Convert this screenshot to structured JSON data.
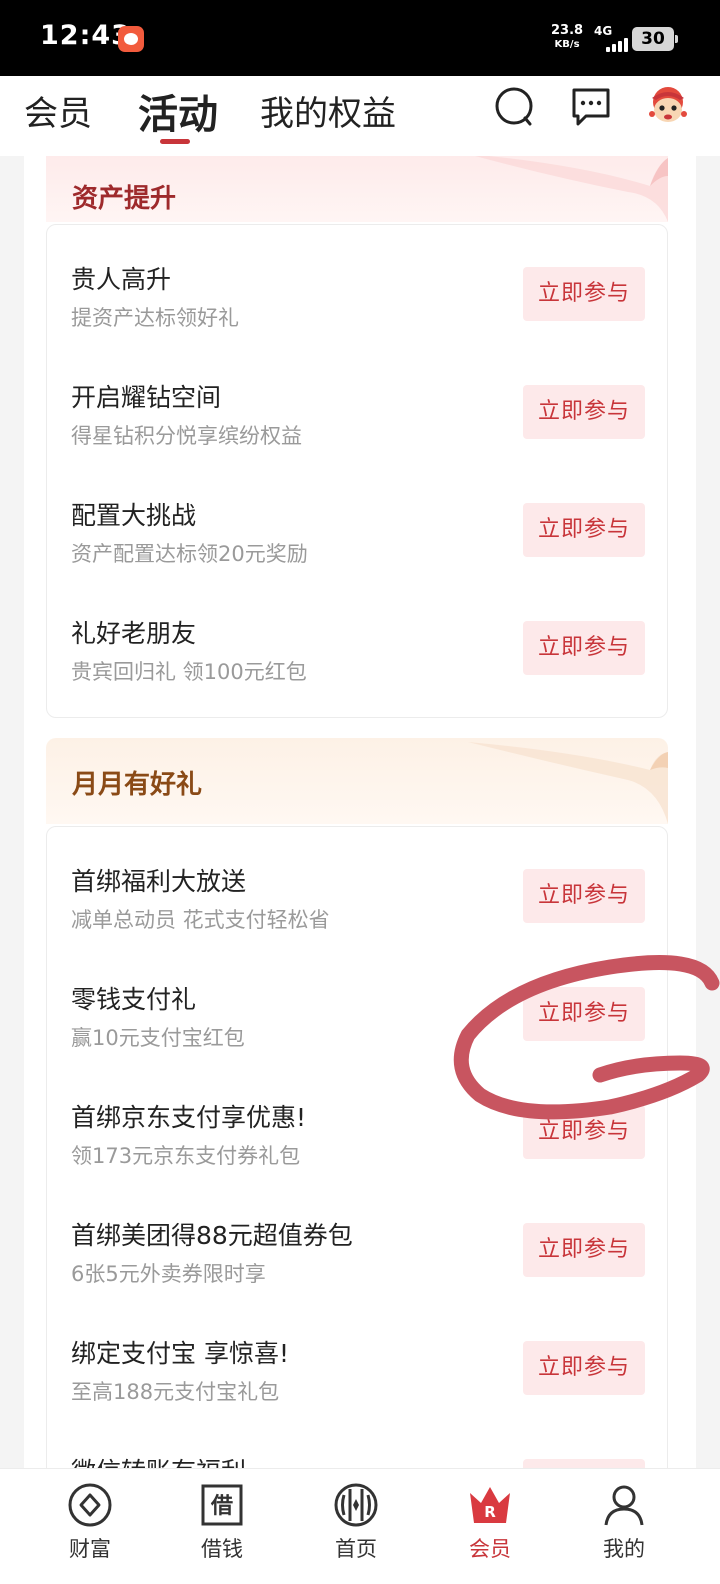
{
  "status_bar": {
    "time": "12:43",
    "net_speed_value": "23.8",
    "net_speed_unit": "KB/s",
    "network_type": "4G",
    "battery": "30"
  },
  "top_nav": {
    "tabs": [
      "会员",
      "活动",
      "我的权益"
    ],
    "active_tab": "活动"
  },
  "sections": [
    {
      "title": "资产提升",
      "items": [
        {
          "title": "贵人高升",
          "subtitle": "提资产达标领好礼",
          "button": "立即参与"
        },
        {
          "title": "开启耀钻空间",
          "subtitle": "得星钻积分悦享缤纷权益",
          "button": "立即参与"
        },
        {
          "title": "配置大挑战",
          "subtitle": "资产配置达标领20元奖励",
          "button": "立即参与"
        },
        {
          "title": "礼好老朋友",
          "subtitle": "贵宾回归礼 领100元红包",
          "button": "立即参与"
        }
      ]
    },
    {
      "title": "月月有好礼",
      "items": [
        {
          "title": "首绑福利大放送",
          "subtitle": "减单总动员 花式支付轻松省",
          "button": "立即参与"
        },
        {
          "title": "零钱支付礼",
          "subtitle": "赢10元支付宝红包",
          "button": "立即参与"
        },
        {
          "title": "首绑京东支付享优惠!",
          "subtitle": "领173元京东支付券礼包",
          "button": "立即参与"
        },
        {
          "title": "首绑美团得88元超值券包",
          "subtitle": "6张5元外卖券限时享",
          "button": "立即参与"
        },
        {
          "title": "绑定支付宝 享惊喜!",
          "subtitle": "至高188元支付宝礼包",
          "button": "立即参与"
        },
        {
          "title": "微信转账有福利",
          "subtitle": "",
          "button": "立即参与"
        }
      ]
    }
  ],
  "bottom_nav": {
    "tabs": [
      {
        "label": "财富",
        "icon": "wealth-icon"
      },
      {
        "label": "借钱",
        "icon": "borrow-icon",
        "icon_text": "借"
      },
      {
        "label": "首页",
        "icon": "home-icon"
      },
      {
        "label": "会员",
        "icon": "member-crown-icon",
        "icon_text": "R"
      },
      {
        "label": "我的",
        "icon": "profile-icon"
      }
    ],
    "active_tab": "会员"
  },
  "colors": {
    "accent": "#c8353a",
    "button_bg": "#fde9ea",
    "section1_title": "#9e2a2c",
    "section2_title": "#8a4a16",
    "annotation": "#c85560"
  }
}
